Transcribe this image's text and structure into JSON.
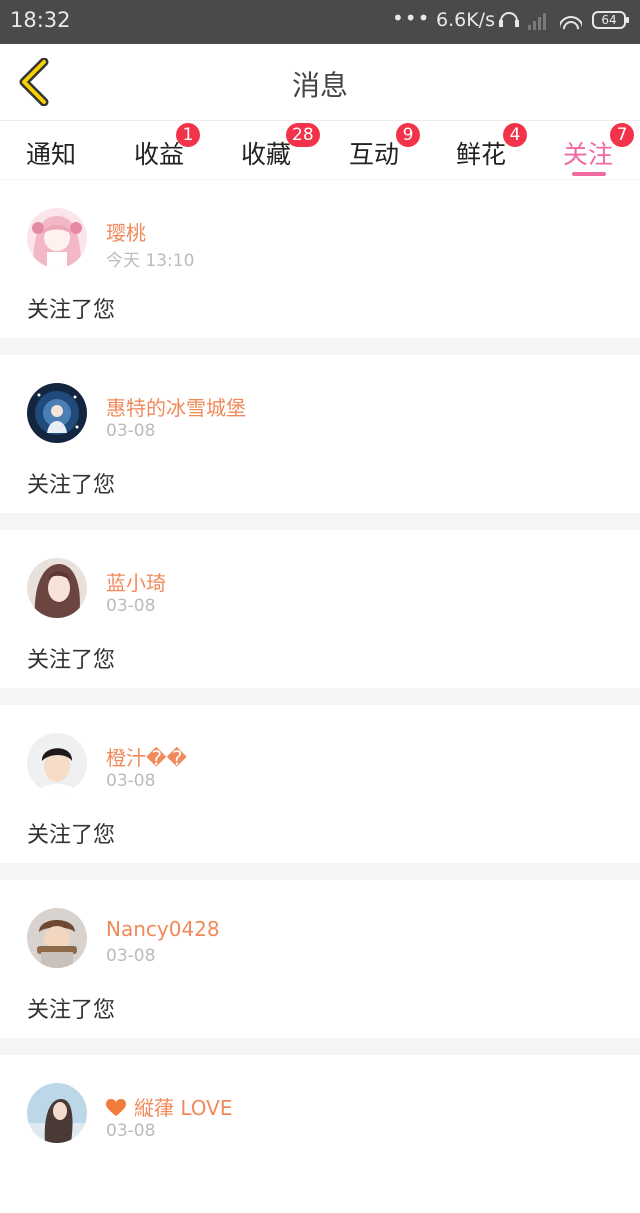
{
  "status_bar": {
    "time": "18:32",
    "dots": "•••",
    "net_speed": "6.6K/s",
    "battery": "64"
  },
  "header": {
    "title": "消息",
    "back_icon": "chevron-left-icon",
    "accent_color": "#f7d000"
  },
  "tabs": [
    {
      "label": "通知",
      "badge": ""
    },
    {
      "label": "收益",
      "badge": "1"
    },
    {
      "label": "收藏",
      "badge": "28"
    },
    {
      "label": "互动",
      "badge": "9"
    },
    {
      "label": "鲜花",
      "badge": "4"
    },
    {
      "label": "关注",
      "badge": "7",
      "active": true
    }
  ],
  "active_tab_color": "#f06aa2",
  "messages": [
    {
      "name": "璎桃",
      "date": "今天 13:10",
      "text": "关注了您",
      "avatar": "pink-haired-anime-girl-avatar"
    },
    {
      "name": "惠特的冰雪城堡",
      "date": "03-08",
      "text": "关注了您",
      "avatar": "night-sky-anime-avatar"
    },
    {
      "name": "蓝小琦",
      "date": "03-08",
      "text": "关注了您",
      "avatar": "brown-haired-anime-girl-avatar"
    },
    {
      "name": "橙汁��",
      "date": "03-08",
      "text": "关注了您",
      "avatar": "boy-portrait-avatar"
    },
    {
      "name": "Nancy0428",
      "date": "03-08",
      "text": "关注了您",
      "avatar": "boy-with-cup-avatar"
    },
    {
      "name": "縦葎 LOVE",
      "date": "03-08",
      "text": "",
      "avatar": "girl-outdoor-avatar",
      "name_icon": "heart-icon"
    }
  ]
}
